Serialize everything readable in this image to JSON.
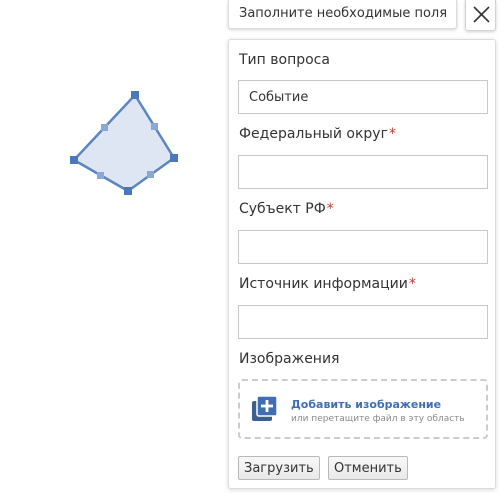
{
  "header": {
    "title": "Заполните необходимые поля",
    "close_icon": "close-icon"
  },
  "map": {
    "shape": "polygon",
    "fill": "#dfe6f3",
    "stroke": "#5b86c2"
  },
  "form": {
    "question_type": {
      "label": "Тип вопроса",
      "value": "Событие"
    },
    "federal_district": {
      "label": "Федеральный округ",
      "required_mark": "*",
      "value": ""
    },
    "subject": {
      "label": "Субъект РФ",
      "required_mark": "*",
      "value": ""
    },
    "source": {
      "label": "Источник информации",
      "required_mark": "*",
      "value": ""
    },
    "images": {
      "label": "Изображения",
      "add_title": "Добавить изображение",
      "add_hint": "или перетащите файл в эту область",
      "icon": "add-image-icon"
    }
  },
  "actions": {
    "upload_label": "Загрузить",
    "cancel_label": "Отменить"
  },
  "colors": {
    "accent": "#3f6fb2",
    "required": "#c0392b"
  }
}
